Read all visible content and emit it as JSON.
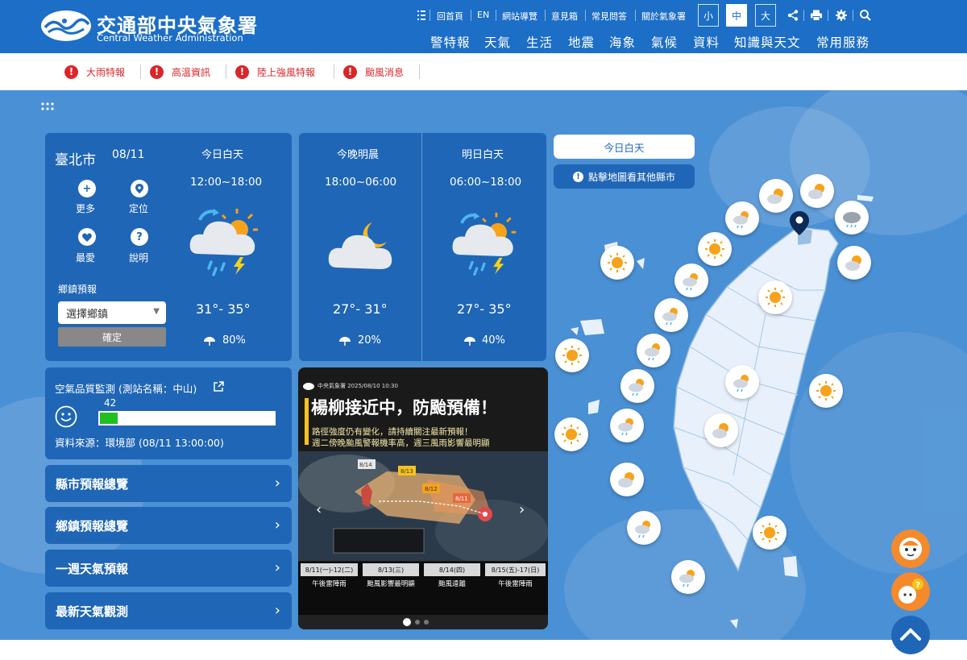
{
  "header": {
    "logo_zh": "交通部中央氣象署",
    "logo_en": "Central Weather Administration",
    "utility_links": [
      "回首頁",
      "EN",
      "網站導覽",
      "意見箱",
      "常見問答",
      "關於氣象署"
    ],
    "font_sizes": [
      "小",
      "中",
      "大"
    ],
    "font_size_selected": "中",
    "main_nav": [
      "警特報",
      "天氣",
      "生活",
      "地震",
      "海象",
      "氣候",
      "資料",
      "知識與天文",
      "常用服務"
    ]
  },
  "alerts": [
    "大雨特報",
    "高溫資訊",
    "陸上強風特報",
    "颱風消息"
  ],
  "local": {
    "city": "臺北市",
    "date": "08/11",
    "actions": [
      "更多",
      "定位",
      "最愛",
      "說明"
    ],
    "township_label": "鄉鎮預報",
    "township_placeholder": "選擇鄉鎮",
    "confirm_label": "確定"
  },
  "forecast": [
    {
      "period": "今日白天",
      "time": "12:00~18:00",
      "temp": "31°- 35°",
      "rain": "80%",
      "icon": "partly-cloudy-thunderstorm-icon"
    },
    {
      "period": "今晚明晨",
      "time": "18:00~06:00",
      "temp": "27°- 31°",
      "rain": "20%",
      "icon": "cloudy-night-icon"
    },
    {
      "period": "明日白天",
      "time": "06:00~18:00",
      "temp": "27°- 35°",
      "rain": "40%",
      "icon": "partly-cloudy-thunderstorm-icon"
    }
  ],
  "air_quality": {
    "title": "空氣品質監測 (測站名稱：中山)",
    "value": "42",
    "level_fraction": 0.1,
    "source": "資料來源：環境部 (08/11 13:00:00)",
    "good_color": "#1fc01f"
  },
  "nav_buttons": [
    "縣市預報總覽",
    "鄉鎮預報總覽",
    "一週天氣預報",
    "最新天氣觀測"
  ],
  "typhoon_card": {
    "publisher": "中央氣象署 2025/08/10 10:30",
    "headline": "楊柳接近中，防颱預備！",
    "line1": "路徑強度仍有變化，請持續關注最新預報！",
    "line2": "週二傍晚颱風警報機率高，週三風雨影響最明顯",
    "track_dates": [
      "8/14",
      "8/13",
      "8/12",
      "8/11"
    ],
    "days": [
      {
        "date": "8/11(一)-12(二)",
        "text": "午後雷陣雨"
      },
      {
        "date": "8/13(三)",
        "text": "颱風影響最明顯"
      },
      {
        "date": "8/14(四)",
        "text": "颱風遠離"
      },
      {
        "date": "8/15(五)-17(日)",
        "text": "午後雷陣雨"
      }
    ]
  },
  "map": {
    "view_label": "今日白天",
    "hint_label": "點擊地圖看其他縣市",
    "pinned_city": "臺北市"
  },
  "colors": {
    "brand": "#1c6ec6",
    "panel": "#1f66b6",
    "alert": "#d9262a",
    "background": "#4a90d4"
  }
}
